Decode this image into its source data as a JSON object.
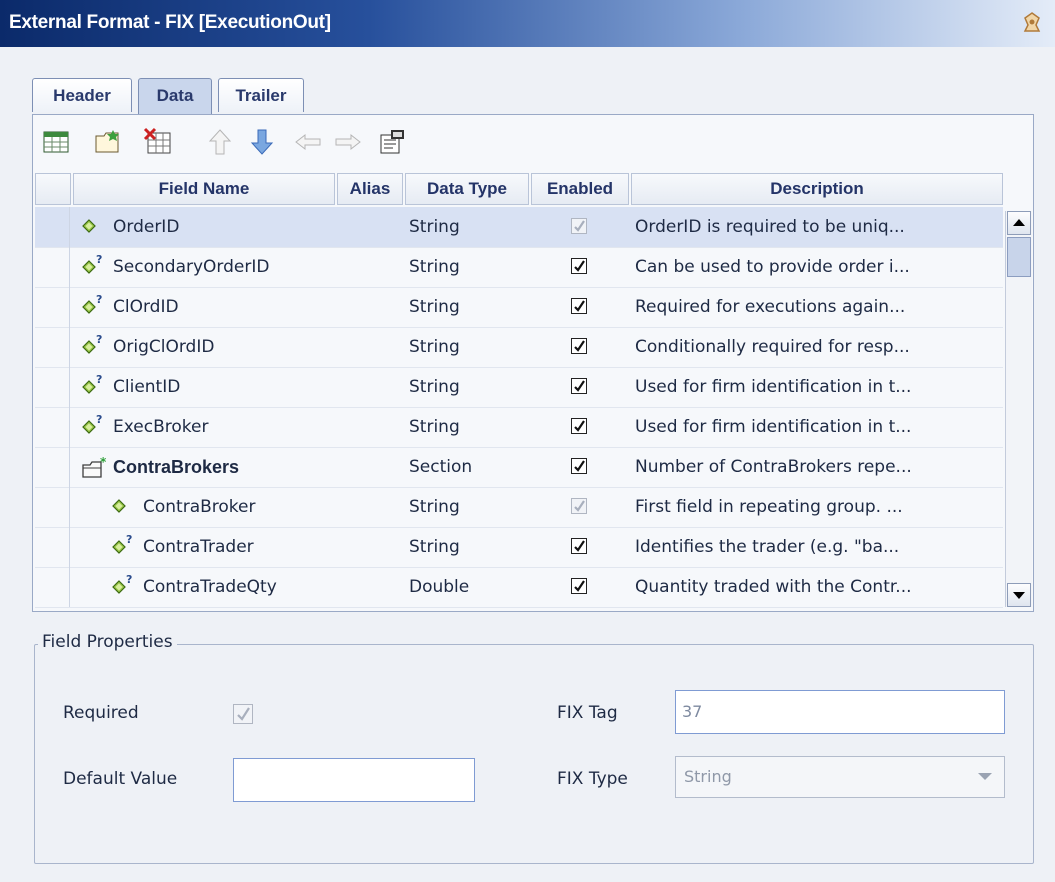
{
  "window": {
    "title": "External Format - FIX [ExecutionOut]"
  },
  "tabs": [
    {
      "label": "Header",
      "active": false
    },
    {
      "label": "Data",
      "active": true
    },
    {
      "label": "Trailer",
      "active": false
    }
  ],
  "toolbar": {
    "buttons": [
      "add-field-icon",
      "add-section-icon",
      "delete-icon",
      "move-up-icon",
      "move-down-icon",
      "outdent-icon",
      "indent-icon",
      "properties-icon"
    ]
  },
  "grid": {
    "headers": {
      "field_name": "Field Name",
      "alias": "Alias",
      "data_type": "Data Type",
      "enabled": "Enabled",
      "description": "Description"
    },
    "rows": [
      {
        "name": "OrderID",
        "icon": "required-field-icon",
        "indent": 0,
        "bold": false,
        "alias": "",
        "type": "String",
        "enabled": true,
        "locked": true,
        "description": "OrderID is required to be uniq...",
        "selected": true
      },
      {
        "name": "SecondaryOrderID",
        "icon": "optional-field-icon",
        "indent": 0,
        "bold": false,
        "alias": "",
        "type": "String",
        "enabled": true,
        "locked": false,
        "description": "Can be used to provide order i...",
        "selected": false
      },
      {
        "name": "ClOrdID",
        "icon": "optional-field-icon",
        "indent": 0,
        "bold": false,
        "alias": "",
        "type": "String",
        "enabled": true,
        "locked": false,
        "description": "Required for executions again...",
        "selected": false
      },
      {
        "name": "OrigClOrdID",
        "icon": "optional-field-icon",
        "indent": 0,
        "bold": false,
        "alias": "",
        "type": "String",
        "enabled": true,
        "locked": false,
        "description": "Conditionally required for resp...",
        "selected": false
      },
      {
        "name": "ClientID",
        "icon": "optional-field-icon",
        "indent": 0,
        "bold": false,
        "alias": "",
        "type": "String",
        "enabled": true,
        "locked": false,
        "description": "Used for firm identification in t...",
        "selected": false
      },
      {
        "name": "ExecBroker",
        "icon": "optional-field-icon",
        "indent": 0,
        "bold": false,
        "alias": "",
        "type": "String",
        "enabled": true,
        "locked": false,
        "description": "Used for firm identification in t...",
        "selected": false
      },
      {
        "name": "ContraBrokers",
        "icon": "section-icon",
        "indent": 0,
        "bold": true,
        "alias": "",
        "type": "Section",
        "enabled": true,
        "locked": false,
        "description": "Number of ContraBrokers repe...",
        "selected": false
      },
      {
        "name": "ContraBroker",
        "icon": "required-field-icon",
        "indent": 1,
        "bold": false,
        "alias": "",
        "type": "String",
        "enabled": true,
        "locked": true,
        "description": "First field in repeating group.  ...",
        "selected": false
      },
      {
        "name": "ContraTrader",
        "icon": "optional-field-icon",
        "indent": 1,
        "bold": false,
        "alias": "",
        "type": "String",
        "enabled": true,
        "locked": false,
        "description": "Identifies the trader (e.g. \"ba...",
        "selected": false
      },
      {
        "name": "ContraTradeQty",
        "icon": "optional-field-icon",
        "indent": 1,
        "bold": false,
        "alias": "",
        "type": "Double",
        "enabled": true,
        "locked": false,
        "description": "Quantity traded with the Contr...",
        "selected": false
      }
    ]
  },
  "field_properties": {
    "legend": "Field Properties",
    "required_label": "Required",
    "required_checked": true,
    "default_value_label": "Default Value",
    "default_value": "",
    "fix_tag_label": "FIX Tag",
    "fix_tag_value": "37",
    "fix_type_label": "FIX Type",
    "fix_type_value": "String"
  },
  "colors": {
    "title_dark": "#0b2a6a",
    "selected_row": "#d8e1f3",
    "required_diamond": "#8ab63a"
  }
}
